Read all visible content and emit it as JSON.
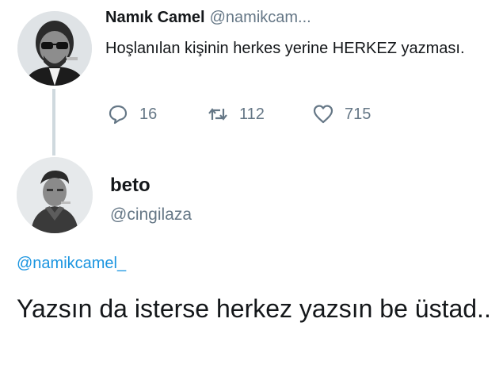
{
  "original_tweet": {
    "display_name": "Namık Camel",
    "handle": "@namikcam...",
    "text": "Hoşlanılan kişinin herkes yerine HERKEZ yazması.",
    "stats": {
      "replies": "16",
      "retweets": "112",
      "likes": "715"
    }
  },
  "reply_tweet": {
    "display_name": "beto",
    "handle": "@cingilaza",
    "mention": "@namikcamel_",
    "text": "Yazsın da isterse herkez yazsın be üstad.."
  },
  "colors": {
    "primary_text": "#14171a",
    "secondary_text": "#657786",
    "link": "#1b95e0",
    "thread_line": "#cfd9de"
  },
  "icons": {
    "reply": "speech-bubble-icon",
    "retweet": "retweet-arrows-icon",
    "like": "heart-outline-icon"
  }
}
